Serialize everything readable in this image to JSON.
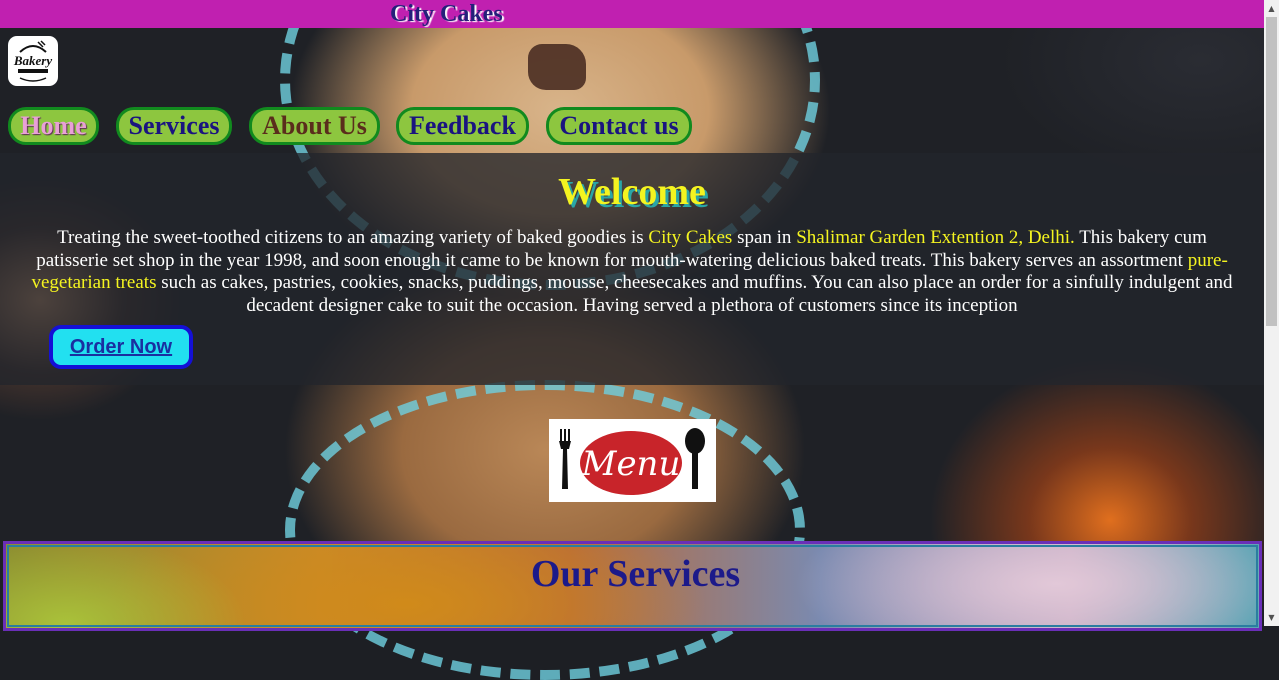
{
  "header": {
    "site_title": "City Cakes"
  },
  "logo": {
    "text": "Bakery",
    "icon": "bakery-logo"
  },
  "nav": {
    "items": [
      {
        "label": "Home",
        "active": true
      },
      {
        "label": "Services",
        "active": false
      },
      {
        "label": "About Us",
        "active": false
      },
      {
        "label": "Feedback",
        "active": false
      },
      {
        "label": "Contact us",
        "active": false
      }
    ]
  },
  "welcome": {
    "title": "Welcome",
    "text_1": "Treating the sweet-toothed citizens to an amazing variety of baked goodies is ",
    "highlight_1": "City Cakes",
    "text_2": " span in ",
    "highlight_2": "Shalimar Garden Extention 2, Delhi.",
    "text_3": " This bakery cum patisserie set shop in the year 1998, and soon enough it came to be known for mouth-watering delicious baked treats. This bakery serves an assortment ",
    "highlight_3": "pure-vegetarian treats",
    "text_4": " such as cakes, pastries, cookies, snacks, puddings, mousse, cheesecakes and muffins. You can also place an order for a sinfully indulgent and decadent designer cake to suit the occasion. Having served a plethora of customers since its inception",
    "order_button": "Order Now"
  },
  "menu_image": {
    "text": "Menu",
    "icons": [
      "fork-icon",
      "spoon-icon"
    ]
  },
  "services": {
    "title": "Our Services"
  },
  "colors": {
    "topbar": "#c020b0",
    "nav_bg": "#8dc63f",
    "nav_border": "#118a1e",
    "highlight": "#f4f420",
    "order_button_bg": "#22e0f0",
    "order_button_border": "#1410d6"
  }
}
